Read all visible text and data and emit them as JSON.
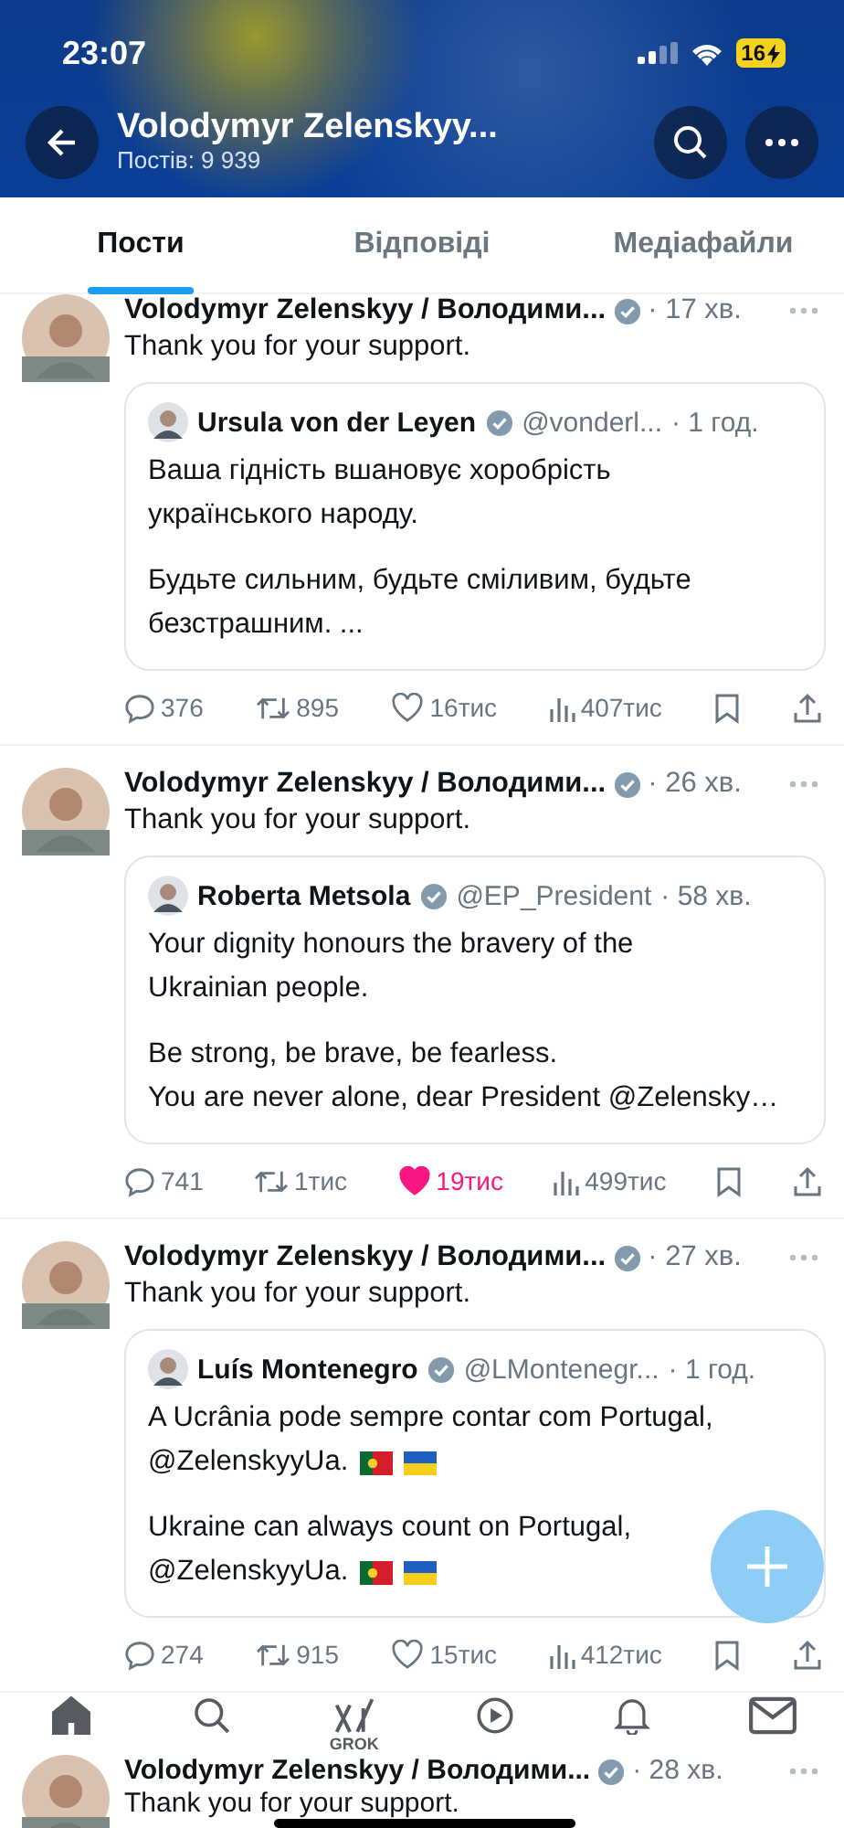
{
  "status_bar": {
    "time": "23:07",
    "battery": "16"
  },
  "header": {
    "title": "Volodymyr Zelenskyy...",
    "subtitle": "Постів: 9 939"
  },
  "tabs": [
    {
      "label": "Пости",
      "selected": true
    },
    {
      "label": "Відповіді",
      "selected": false
    },
    {
      "label": "Медіафайли",
      "selected": false
    }
  ],
  "posts": [
    {
      "name": "Volodymyr Zelenskyy / Володими...",
      "time": "· 17 хв.",
      "text": "Thank you for your support.",
      "quote": {
        "name": "Ursula von der Leyen",
        "handle": "@vonderl...",
        "time": "· 1 год.",
        "paragraphs": [
          [
            {
              "text": "Ваша гідність вшановує хоробрість"
            },
            {
              "text": "українського народу."
            }
          ],
          [
            {
              "text": "Будьте сильним, будьте сміливим, будьте"
            },
            {
              "text": "безстрашним. ..."
            }
          ]
        ]
      },
      "actions": {
        "replies": "376",
        "reposts": "895",
        "likes": "16тис",
        "liked": false,
        "views": "407тис"
      }
    },
    {
      "name": "Volodymyr Zelenskyy / Володими...",
      "time": "· 26 хв.",
      "text": "Thank you for your support.",
      "quote": {
        "name": "Roberta Metsola",
        "handle": "@EP_President",
        "time": "· 58 хв.",
        "paragraphs": [
          [
            {
              "text": "Your dignity honours the bravery of the"
            },
            {
              "text": "Ukrainian people."
            }
          ],
          [
            {
              "text": "Be strong, be brave, be fearless."
            },
            {
              "text": "You are never alone, dear President @Zelensky…"
            }
          ]
        ]
      },
      "actions": {
        "replies": "741",
        "reposts": "1тис",
        "likes": "19тис",
        "liked": true,
        "views": "499тис"
      }
    },
    {
      "name": "Volodymyr Zelenskyy / Володими...",
      "time": "· 27 хв.",
      "text": "Thank you for your support.",
      "quote": {
        "name": "Luís Montenegro",
        "handle": "@LMontenegr...",
        "time": "· 1 год.",
        "paragraphs": [
          [
            {
              "text": "A Ucrânia pode sempre contar com Portugal,"
            },
            {
              "text": "@ZelenskyyUa.",
              "flags": [
                {
                  "kind": "portugal"
                },
                {
                  "kind": "ukraine"
                }
              ]
            }
          ],
          [
            {
              "text": "Ukraine can always count on Portugal,"
            },
            {
              "text": "@ZelenskyyUa.",
              "flags": [
                {
                  "kind": "portugal"
                },
                {
                  "kind": "ukraine"
                }
              ]
            }
          ]
        ]
      },
      "actions": {
        "replies": "274",
        "reposts": "915",
        "likes": "15тис",
        "liked": false,
        "views": "412тис"
      }
    },
    {
      "name": "Volodymyr Zelenskyy / Володими...",
      "time": "· 28 хв.",
      "text": "Thank you for your support."
    }
  ],
  "bottom_nav": [
    {
      "kind": "home",
      "selected": true
    },
    {
      "kind": "search",
      "selected": false
    },
    {
      "kind": "grok",
      "label": "GROK",
      "selected": false
    },
    {
      "kind": "video",
      "selected": false
    },
    {
      "kind": "bell",
      "selected": false
    },
    {
      "kind": "mail",
      "selected": false
    }
  ]
}
